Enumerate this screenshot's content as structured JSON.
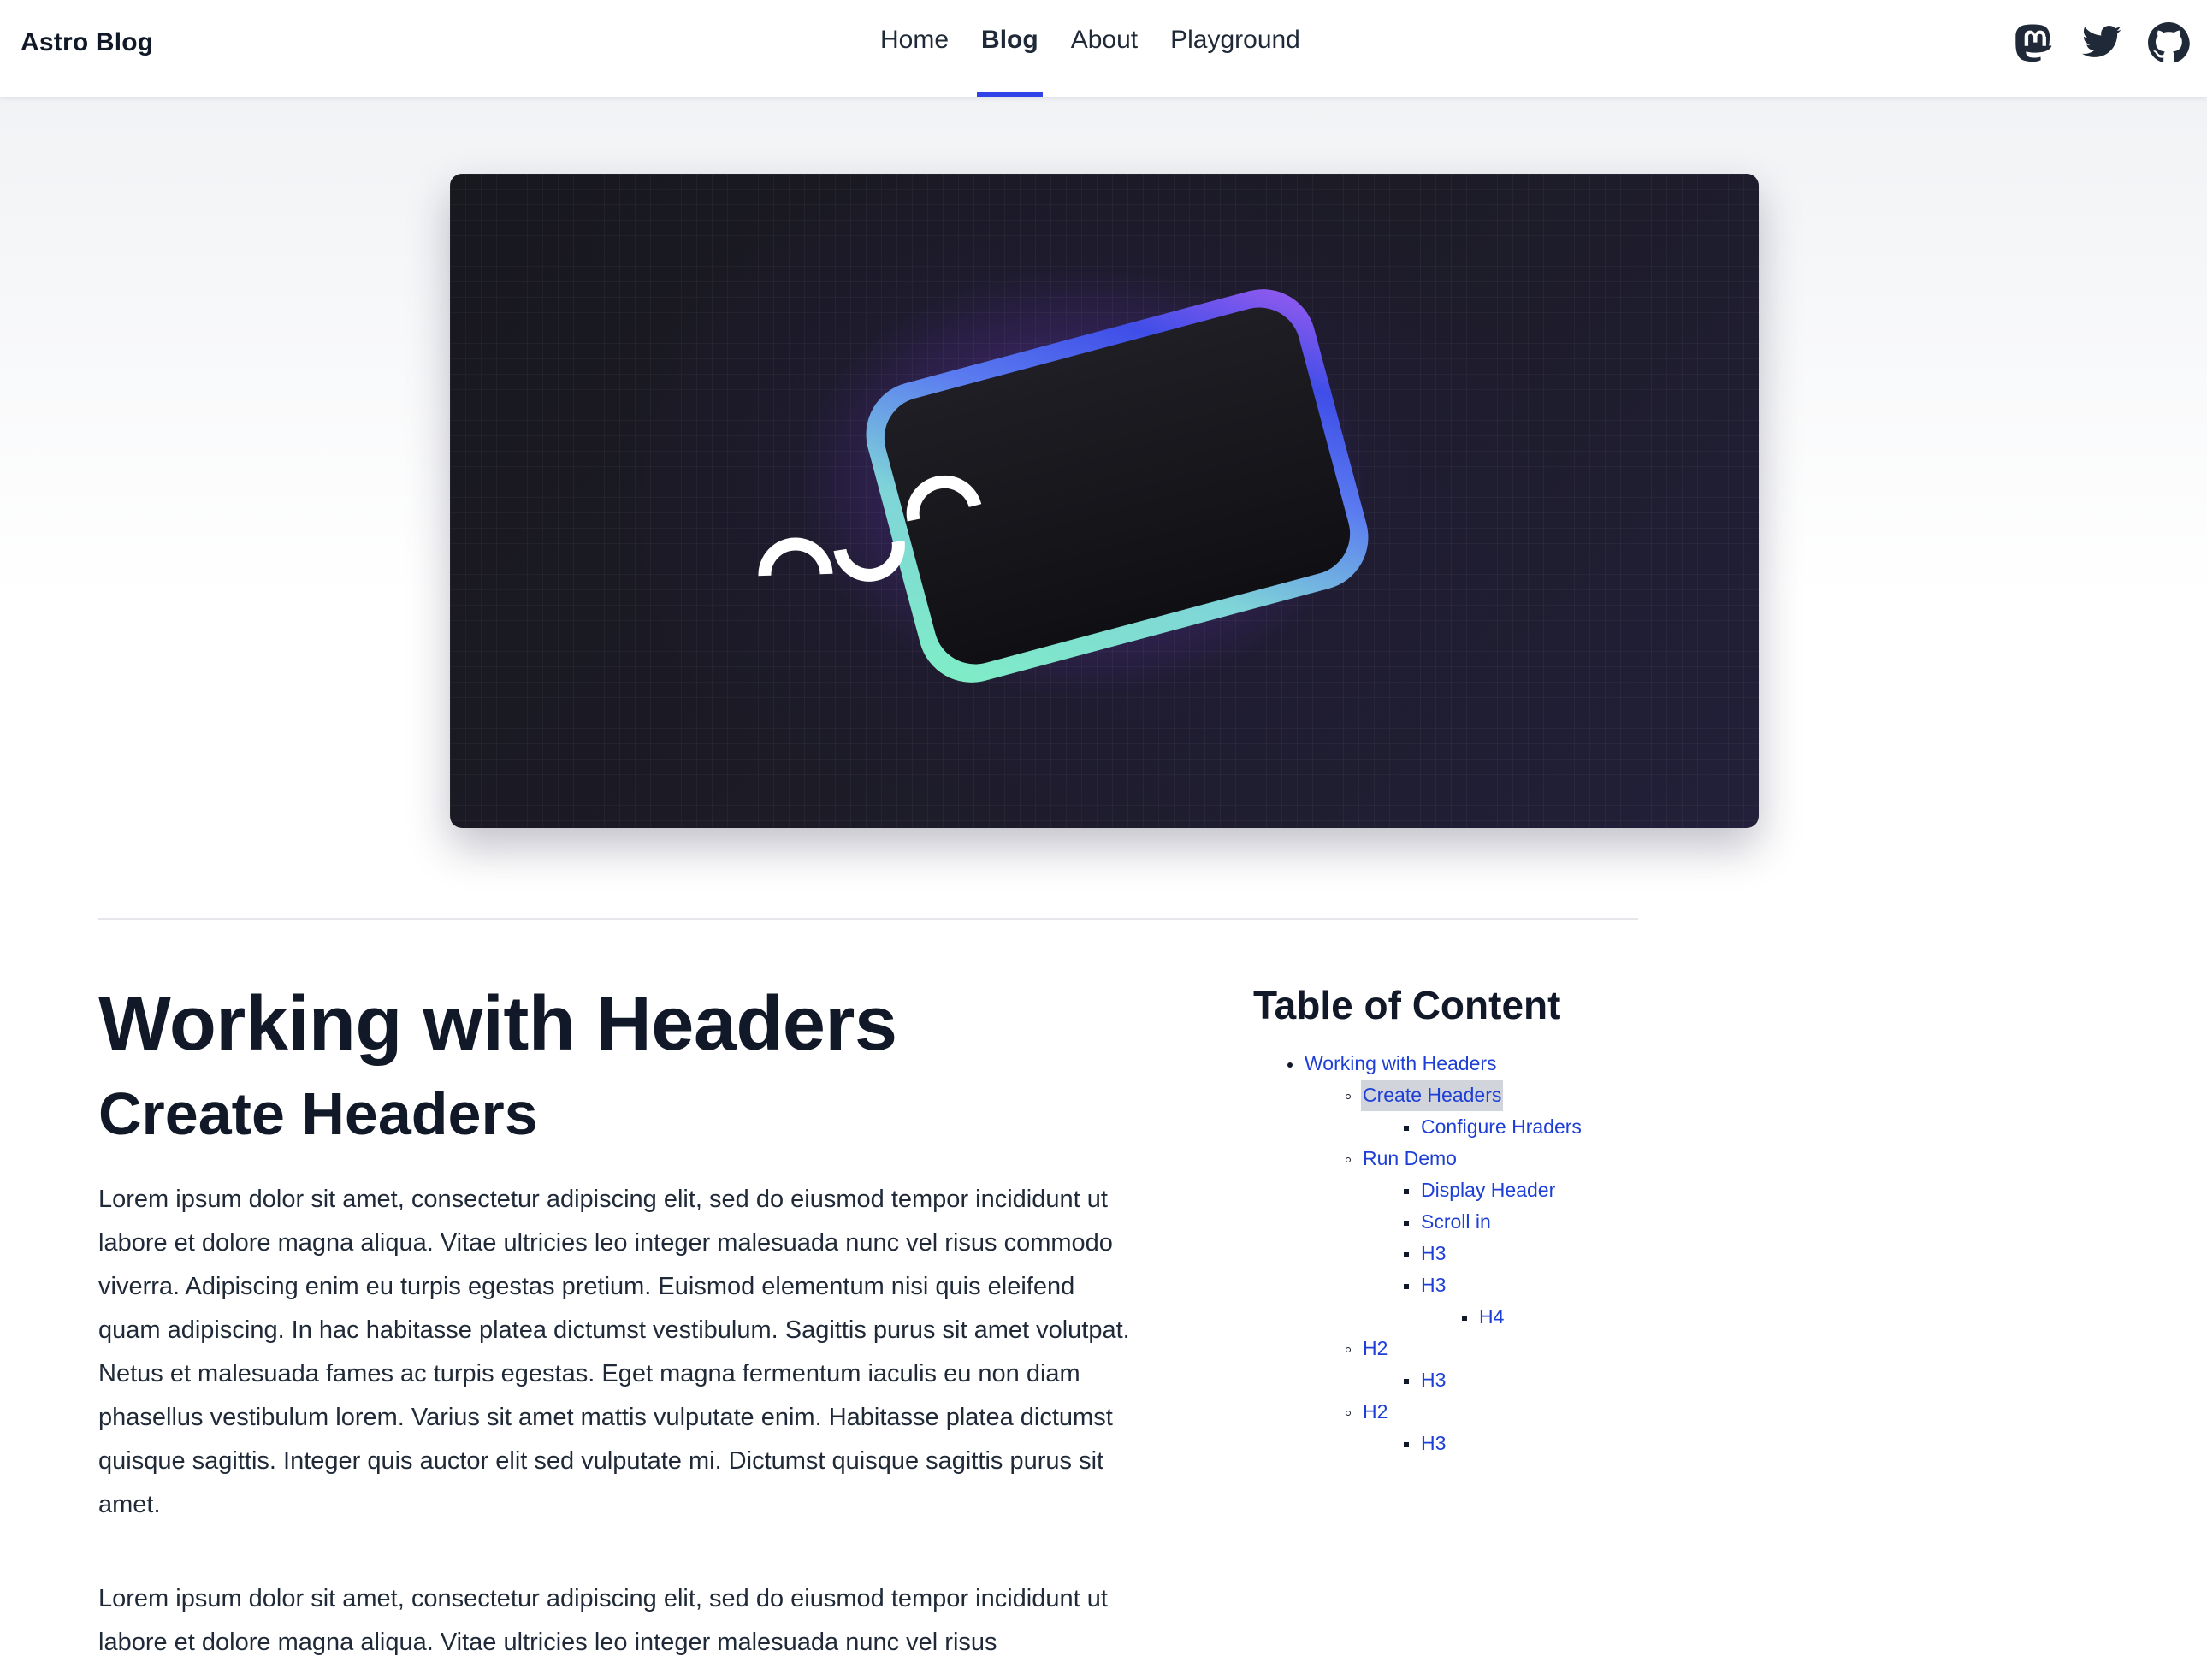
{
  "header": {
    "brand": "Astro Blog",
    "nav": [
      {
        "label": "Home",
        "active": false
      },
      {
        "label": "Blog",
        "active": true
      },
      {
        "label": "About",
        "active": false
      },
      {
        "label": "Playground",
        "active": false
      }
    ],
    "social_icons": [
      "mastodon-icon",
      "twitter-icon",
      "github-icon"
    ],
    "accent_color": "#2f43e6"
  },
  "hero": {
    "image": "astro-mascot-illustration"
  },
  "article": {
    "title": "Working with Headers",
    "subtitle": "Create Headers",
    "paragraphs": [
      "Lorem ipsum dolor sit amet, consectetur adipiscing elit, sed do eiusmod tempor incididunt ut labore et dolore magna aliqua. Vitae ultricies leo integer malesuada nunc vel risus commodo viverra. Adipiscing enim eu turpis egestas pretium. Euismod elementum nisi quis eleifend quam adipiscing. In hac habitasse platea dictumst vestibulum. Sagittis purus sit amet volutpat. Netus et malesuada fames ac turpis egestas. Eget magna fermentum iaculis eu non diam phasellus vestibulum lorem. Varius sit amet mattis vulputate enim. Habitasse platea dictumst quisque sagittis. Integer quis auctor elit sed vulputate mi. Dictumst quisque sagittis purus sit amet.",
      "Lorem ipsum dolor sit amet, consectetur adipiscing elit, sed do eiusmod tempor incididunt ut labore et dolore magna aliqua. Vitae ultricies leo integer malesuada nunc vel risus"
    ]
  },
  "toc": {
    "title": "Table of Content",
    "link_color": "#1d3fd6",
    "items": [
      {
        "label": "Working with Headers",
        "level": 1
      },
      {
        "label": "Create Headers",
        "level": 2,
        "highlighted": true
      },
      {
        "label": "Configure Hraders",
        "level": 3
      },
      {
        "label": "Run Demo",
        "level": 2
      },
      {
        "label": "Display Header",
        "level": 3
      },
      {
        "label": "Scroll in",
        "level": 3
      },
      {
        "label": "H3",
        "level": 3
      },
      {
        "label": "H3",
        "level": 3
      },
      {
        "label": "H4",
        "level": 4
      },
      {
        "label": "H2",
        "level": 2
      },
      {
        "label": "H3",
        "level": 3
      },
      {
        "label": "H2",
        "level": 2
      },
      {
        "label": "H3",
        "level": 3
      }
    ]
  }
}
